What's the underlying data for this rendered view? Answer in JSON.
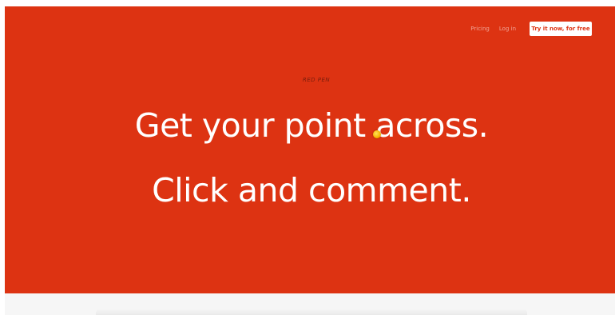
{
  "nav": {
    "pricing_label": "Pricing",
    "login_label": "Log in",
    "cta_label": "Try it now, for free"
  },
  "hero": {
    "brand": "RED PEN",
    "headline_1": "Get your point across.",
    "headline_2": "Click and comment."
  },
  "colors": {
    "hero_background": "#dd3312",
    "cta_background": "#ffffff",
    "cta_text": "#dd3312",
    "cursor_marker": "#f6b400"
  },
  "icons": {
    "cursor_marker": "comment-dot-icon"
  }
}
